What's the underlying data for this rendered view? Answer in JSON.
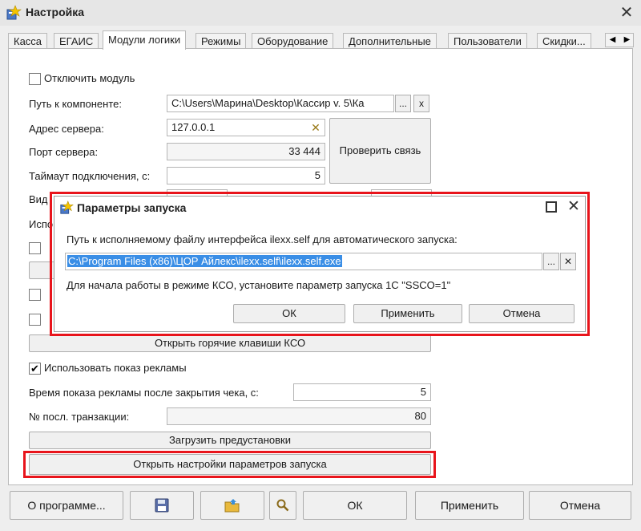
{
  "window": {
    "title": "Настройка"
  },
  "tabs": [
    {
      "label": "Касса"
    },
    {
      "label": "ЕГАИС"
    },
    {
      "label": "Модули логики",
      "active": true
    },
    {
      "label": "Режимы"
    },
    {
      "label": "Оборудование"
    },
    {
      "label": "Дополнительные"
    },
    {
      "label": "Пользователи"
    },
    {
      "label": "Скидки..."
    }
  ],
  "form": {
    "disable_module_label": "Отключить модуль",
    "component_path_label": "Путь к компоненте:",
    "component_path_value": "C:\\Users\\Марина\\Desktop\\Кассир v. 5\\Ка",
    "browse_label": "...",
    "clear_label": "x",
    "server_address_label": "Адрес сервера:",
    "server_address_value": "127.0.0.1",
    "server_port_label": "Порт сервера:",
    "server_port_value": "33 444",
    "check_connection_label": "Проверить связь",
    "timeout_label": "Таймаут подключения, с:",
    "timeout_value": "5",
    "view_label_partial": "Вид",
    "use_label_partial": "Испо",
    "open_hotkeys_label": "Открыть горячие клавиши КСО",
    "use_ads_label": "Использовать показ рекламы",
    "ad_time_label": "Время показа рекламы после закрытия чека, с:",
    "ad_time_value": "5",
    "last_transaction_label": "№ посл. транзакции:",
    "last_transaction_value": "80",
    "load_presets_label": "Загрузить предустановки",
    "open_launch_settings_label": "Открыть настройки параметров запуска"
  },
  "dialog": {
    "title": "Параметры запуска",
    "path_label": "Путь к исполняемому файлу интерфейса ilexx.self для автоматического запуска:",
    "path_value": "C:\\Program Files (x86)\\ЦОР Айлекс\\ilexx.self\\ilexx.self.exe",
    "hint": "Для начала работы в режиме КСО, установите параметр запуска 1С \"SSCO=1\"",
    "ok_label": "ОК",
    "apply_label": "Применить",
    "cancel_label": "Отмена"
  },
  "bottom": {
    "about_label": "О программе...",
    "ok_label": "ОК",
    "apply_label": "Применить",
    "cancel_label": "Отмена"
  },
  "icons": {
    "app": "settings-app-icon",
    "save": "floppy-disk-icon",
    "open": "folder-open-icon",
    "search": "magnifier-icon"
  },
  "colors": {
    "highlight": "#e8141b",
    "selection": "#3a8ee6"
  }
}
